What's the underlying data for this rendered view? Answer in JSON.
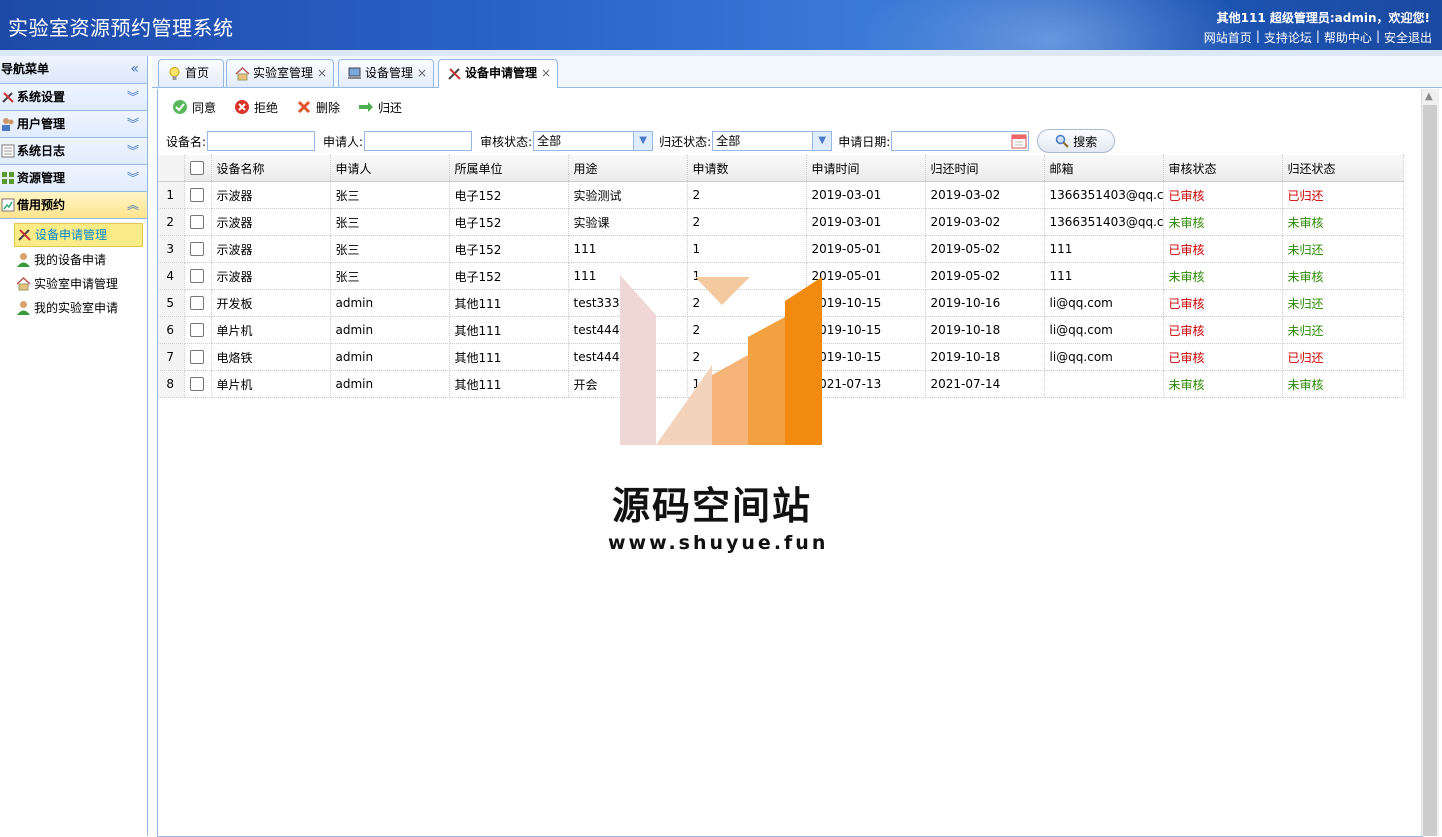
{
  "header": {
    "system_name": "实验室资源预约管理系统",
    "welcome": "其他111 超级管理员:admin，欢迎您!",
    "links": [
      "网站首页",
      "支持论坛",
      "帮助中心",
      "安全退出"
    ]
  },
  "sidebar": {
    "title": "导航菜单",
    "sections": [
      {
        "label": "系统设置",
        "icon": "tools-icon"
      },
      {
        "label": "用户管理",
        "icon": "users-icon"
      },
      {
        "label": "系统日志",
        "icon": "log-icon"
      },
      {
        "label": "资源管理",
        "icon": "grid-icon"
      },
      {
        "label": "借用预约",
        "icon": "chart-icon"
      }
    ],
    "sub_items": [
      "设备申请管理",
      "我的设备申请",
      "实验室申请管理",
      "我的实验室申请"
    ]
  },
  "tabs": [
    {
      "label": "首页",
      "icon": "bulb-icon"
    },
    {
      "label": "实验室管理",
      "icon": "home-icon"
    },
    {
      "label": "设备管理",
      "icon": "computer-icon"
    },
    {
      "label": "设备申请管理",
      "icon": "tools-icon"
    }
  ],
  "toolbar": {
    "approve": "同意",
    "reject": "拒绝",
    "delete": "删除",
    "return": "归还"
  },
  "search": {
    "device_label": "设备名:",
    "applicant_label": "申请人:",
    "audit_label": "审核状态:",
    "audit_value": "全部",
    "return_label": "归还状态:",
    "return_value": "全部",
    "date_label": "申请日期:",
    "button": "搜索"
  },
  "grid": {
    "columns": [
      "设备名称",
      "申请人",
      "所属单位",
      "用途",
      "申请数",
      "申请时间",
      "归还时间",
      "邮箱",
      "审核状态",
      "归还状态"
    ],
    "rows": [
      [
        "1",
        "示波器",
        "张三",
        "电子152",
        "实验测试",
        "2",
        "2019-03-01",
        "2019-03-02",
        "1366351403@qq.co",
        "已审核",
        "已归还"
      ],
      [
        "2",
        "示波器",
        "张三",
        "电子152",
        "实验课",
        "2",
        "2019-03-01",
        "2019-03-02",
        "1366351403@qq.co",
        "未审核",
        "未审核"
      ],
      [
        "3",
        "示波器",
        "张三",
        "电子152",
        "111",
        "1",
        "2019-05-01",
        "2019-05-02",
        "111",
        "已审核",
        "未归还"
      ],
      [
        "4",
        "示波器",
        "张三",
        "电子152",
        "111",
        "1",
        "2019-05-01",
        "2019-05-02",
        "111",
        "未审核",
        "未审核"
      ],
      [
        "5",
        "开发板",
        "admin",
        "其他111",
        "test333",
        "2",
        "2019-10-15",
        "2019-10-16",
        "li@qq.com",
        "已审核",
        "未归还"
      ],
      [
        "6",
        "单片机",
        "admin",
        "其他111",
        "test444",
        "2",
        "2019-10-15",
        "2019-10-18",
        "li@qq.com",
        "已审核",
        "未归还"
      ],
      [
        "7",
        "电烙铁",
        "admin",
        "其他111",
        "test444",
        "2",
        "2019-10-15",
        "2019-10-18",
        "li@qq.com",
        "已审核",
        "已归还"
      ],
      [
        "8",
        "单片机",
        "admin",
        "其他111",
        "开会",
        "1",
        "2021-07-13",
        "2021-07-14",
        "",
        "未审核",
        "未审核"
      ]
    ]
  },
  "watermark": {
    "title": "源码空间站",
    "url": "www.shuyue.fun"
  },
  "colors": {
    "approved_red": "#cc0000",
    "pending_green": "#2a8a00",
    "border_blue": "#95b8e7",
    "selected_yellow": "#fbec88"
  }
}
